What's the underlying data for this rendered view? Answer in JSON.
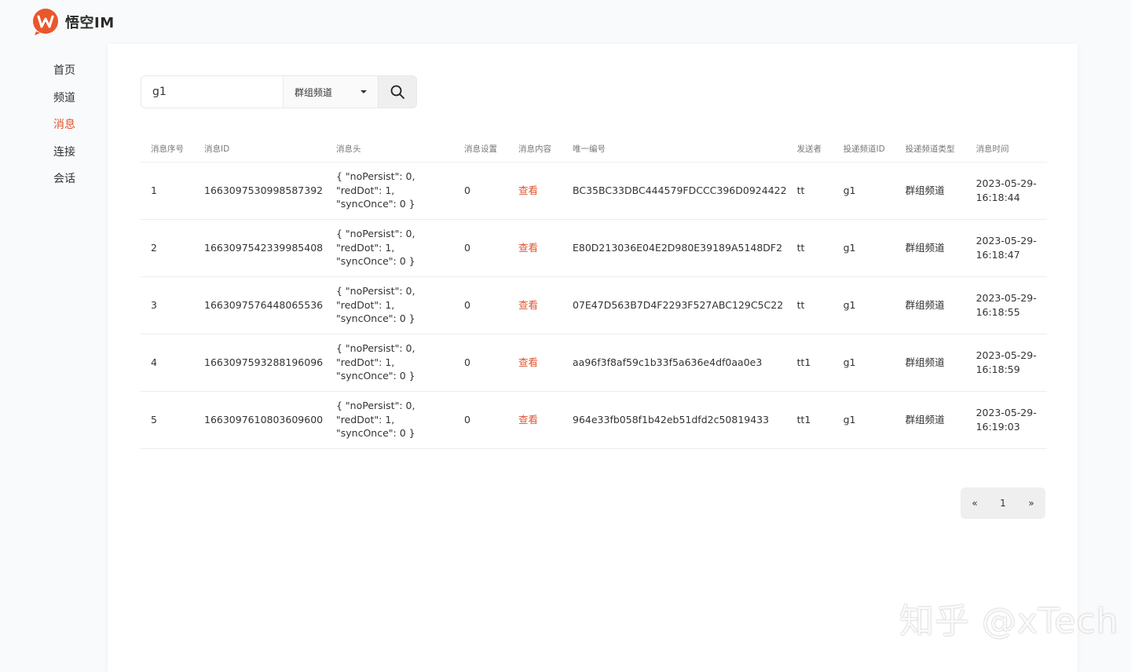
{
  "app": {
    "name": "悟空IM"
  },
  "sidebar": {
    "items": [
      {
        "label": "首页"
      },
      {
        "label": "频道"
      },
      {
        "label": "消息"
      },
      {
        "label": "连接"
      },
      {
        "label": "会话"
      }
    ],
    "active_label": "消息"
  },
  "search": {
    "value": "g1",
    "channel_type_selected": "群组频道"
  },
  "table": {
    "columns": [
      "消息序号",
      "消息ID",
      "消息头",
      "消息设置",
      "消息内容",
      "唯一编号",
      "发送者",
      "投递频道ID",
      "投递频道类型",
      "消息时间"
    ],
    "rows": [
      {
        "seq": "1",
        "message_id": "1663097530998587392",
        "header": "{ \"noPersist\": 0,\n\"redDot\": 1,\n\"syncOnce\": 0 }",
        "setting": "0",
        "content": "查看",
        "client_msg_no": "BC35BC33DBC444579FDCCC396D0924422",
        "from": "tt",
        "channel_id": "g1",
        "channel_type": "群组频道",
        "time": "2023-05-29-\n16:18:44"
      },
      {
        "seq": "2",
        "message_id": "1663097542339985408",
        "header": "{ \"noPersist\": 0,\n\"redDot\": 1,\n\"syncOnce\": 0 }",
        "setting": "0",
        "content": "查看",
        "client_msg_no": "E80D213036E04E2D980E39189A5148DF2",
        "from": "tt",
        "channel_id": "g1",
        "channel_type": "群组频道",
        "time": "2023-05-29-\n16:18:47"
      },
      {
        "seq": "3",
        "message_id": "1663097576448065536",
        "header": "{ \"noPersist\": 0,\n\"redDot\": 1,\n\"syncOnce\": 0 }",
        "setting": "0",
        "content": "查看",
        "client_msg_no": "07E47D563B7D4F2293F527ABC129C5C22",
        "from": "tt",
        "channel_id": "g1",
        "channel_type": "群组频道",
        "time": "2023-05-29-\n16:18:55"
      },
      {
        "seq": "4",
        "message_id": "1663097593288196096",
        "header": "{ \"noPersist\": 0,\n\"redDot\": 1,\n\"syncOnce\": 0 }",
        "setting": "0",
        "content": "查看",
        "client_msg_no": "aa96f3f8af59c1b33f5a636e4df0aa0e3",
        "from": "tt1",
        "channel_id": "g1",
        "channel_type": "群组频道",
        "time": "2023-05-29-\n16:18:59"
      },
      {
        "seq": "5",
        "message_id": "1663097610803609600",
        "header": "{ \"noPersist\": 0,\n\"redDot\": 1,\n\"syncOnce\": 0 }",
        "setting": "0",
        "content": "查看",
        "client_msg_no": "964e33fb058f1b42eb51dfd2c50819433",
        "from": "tt1",
        "channel_id": "g1",
        "channel_type": "群组频道",
        "time": "2023-05-29-\n16:19:03"
      }
    ]
  },
  "pagination": {
    "prev": "«",
    "current": "1",
    "next": "»"
  },
  "watermark": {
    "text": "知乎 @xTech"
  },
  "colors": {
    "accent": "#e0552f",
    "background": "#f9fafb",
    "card": "#ffffff"
  },
  "icons": {
    "logo": "wukong-logo-icon",
    "search": "search-icon",
    "dropdown": "caret-down-icon"
  }
}
